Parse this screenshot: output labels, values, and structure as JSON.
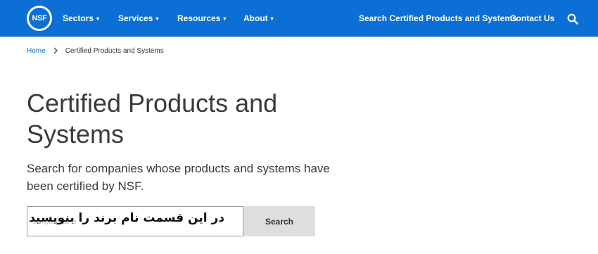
{
  "header": {
    "logo_text": "NSF",
    "nav": [
      {
        "label": "Sectors",
        "caret": "▾"
      },
      {
        "label": "Services",
        "caret": "▾"
      },
      {
        "label": "Resources",
        "caret": "▾"
      },
      {
        "label": "About",
        "caret": "▾"
      }
    ],
    "right_links": [
      {
        "label": "Search Certified Products and Systems"
      },
      {
        "label": "Contact Us"
      }
    ],
    "search_icon": "search-icon"
  },
  "breadcrumb": {
    "items": [
      "Home",
      "Certified Products and Systems"
    ],
    "separator_icon": "chevron-right-icon"
  },
  "main": {
    "title": "Certified Products and Systems",
    "subtitle": "Search for companies whose products and systems have been certified by NSF.",
    "search": {
      "placeholder": "company name",
      "value": "",
      "overlay_note": "در این قسمت نام برند را بنویسید",
      "button_label": "Search"
    }
  },
  "colors": {
    "nav_bg": "#0b6fd6",
    "link": "#0b6fd6",
    "text": "#3a3a3a",
    "button_bg": "#dedede"
  }
}
